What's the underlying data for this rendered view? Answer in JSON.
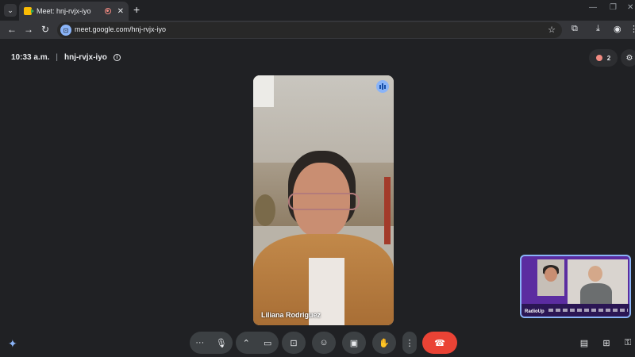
{
  "browser": {
    "tab_title": "Meet: hnj-rvjx-iyo",
    "new_tab": "+",
    "url": "meet.google.com/hnj-rvjx-iyo"
  },
  "meeting": {
    "time": "10:33 a.m.",
    "separator": "|",
    "code": "hnj-rvjx-iyo",
    "participant_count": "2"
  },
  "main_video": {
    "name": "Liliana Rodriguez"
  },
  "pip": {
    "label": "RadioUp"
  },
  "controls": {
    "more_label": "···",
    "colors": {
      "end_call": "#ea4335",
      "accent": "#8ab4f8",
      "background": "#202124"
    }
  },
  "icons": [
    "back-icon",
    "forward-icon",
    "reload-icon",
    "meet-url-icon",
    "star-icon",
    "extensions-icon",
    "download-icon",
    "profile-icon",
    "more-vert-icon",
    "info-icon",
    "people-icon",
    "host-controls-icon",
    "speaking-icon",
    "microphone-icon",
    "camera-icon",
    "present-icon",
    "emoji-icon",
    "captions-icon",
    "raise-hand-icon",
    "end-call-icon",
    "chat-icon",
    "activities-icon",
    "lock-icon",
    "gemini-icon"
  ]
}
